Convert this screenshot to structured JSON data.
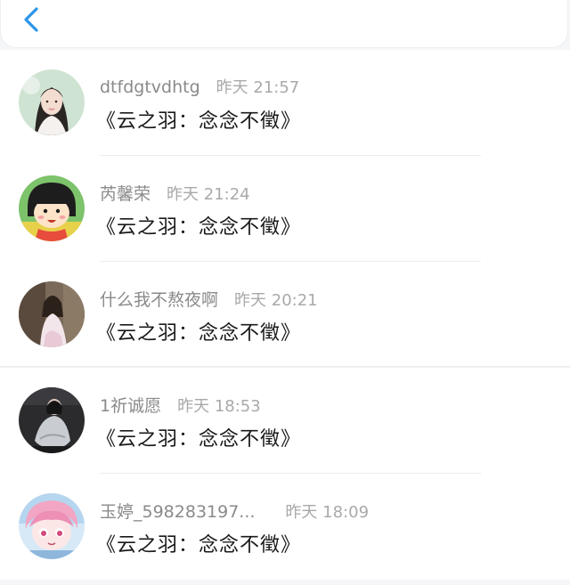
{
  "header": {
    "back_icon": "chevron-left-icon",
    "accent_color": "#2b95e9"
  },
  "comments": [
    {
      "username": "dtfdgtvdhtg",
      "time": "昨天 21:57",
      "text": "《云之羽：念念不徵》"
    },
    {
      "username": "芮馨荣",
      "time": "昨天 21:24",
      "text": "《云之羽：念念不徵》"
    },
    {
      "username": "什么我不熬夜啊",
      "time": "昨天 20:21",
      "text": "《云之羽：念念不徵》"
    },
    {
      "username": "1祈诚愿",
      "time": "昨天 18:53",
      "text": "《云之羽：念念不徵》"
    },
    {
      "username": "玉婷_598283197...",
      "time": "昨天 18:09",
      "text": "《云之羽：念念不徵》"
    }
  ]
}
